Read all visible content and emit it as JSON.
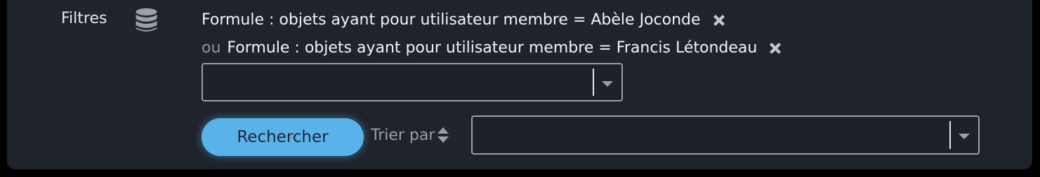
{
  "filters": {
    "label": "Filtres",
    "icon": "database-icon",
    "rules": [
      {
        "prefix": "",
        "text": "Formule : objets ayant pour utilisateur membre = Abèle Joconde",
        "remove_icon": "close-x-icon"
      },
      {
        "prefix": "ou",
        "text": "Formule : objets ayant pour utilisateur membre = Francis Létondeau",
        "remove_icon": "close-x-icon"
      }
    ],
    "add_filter_select": {
      "value": ""
    }
  },
  "actions": {
    "search_label": "Rechercher",
    "sort_label": "Trier par",
    "sort_icon": "sort-up-down-icon",
    "sort_select": {
      "value": ""
    }
  },
  "colors": {
    "panel_bg": "#1f232b",
    "accent": "#5ab2ea",
    "text": "#f2f3f5",
    "muted": "#8d939c"
  }
}
